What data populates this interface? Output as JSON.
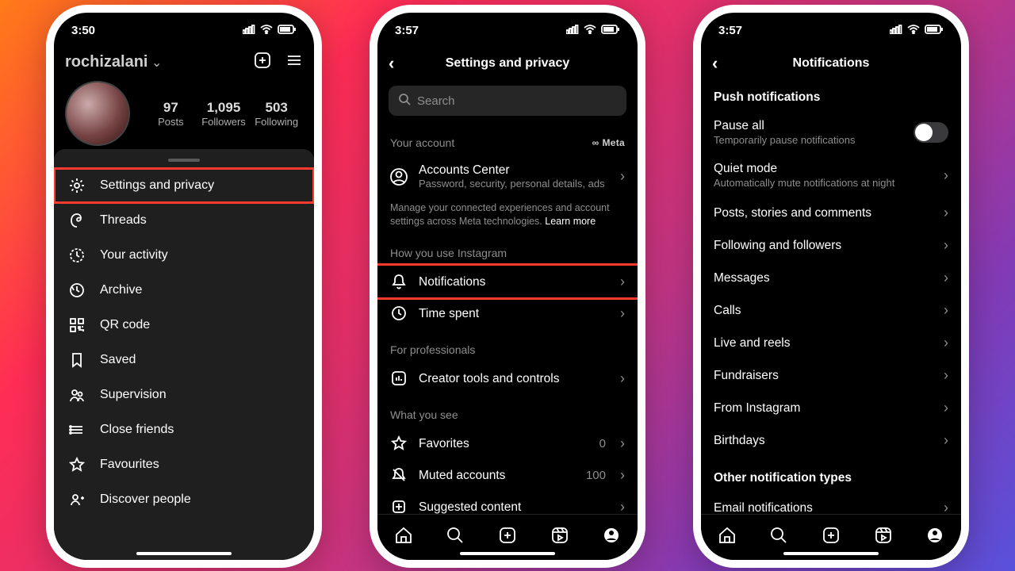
{
  "phone1": {
    "status_time": "3:50",
    "username": "rochizalani",
    "stats": {
      "posts_n": "97",
      "posts_l": "Posts",
      "followers_n": "1,095",
      "followers_l": "Followers",
      "following_n": "503",
      "following_l": "Following"
    },
    "menu": [
      {
        "icon": "gear",
        "label": "Settings and privacy",
        "hl": true
      },
      {
        "icon": "threads",
        "label": "Threads"
      },
      {
        "icon": "activity",
        "label": "Your activity"
      },
      {
        "icon": "archive",
        "label": "Archive"
      },
      {
        "icon": "qr",
        "label": "QR code"
      },
      {
        "icon": "saved",
        "label": "Saved"
      },
      {
        "icon": "supervision",
        "label": "Supervision"
      },
      {
        "icon": "close-friends",
        "label": "Close friends"
      },
      {
        "icon": "star",
        "label": "Favourites"
      },
      {
        "icon": "discover",
        "label": "Discover people"
      }
    ]
  },
  "phone2": {
    "status_time": "3:57",
    "title": "Settings and privacy",
    "search_placeholder": "Search",
    "sec_account_label": "Your account",
    "meta_label": "Meta",
    "ac_title": "Accounts Center",
    "ac_sub": "Password, security, personal details, ads",
    "ac_note": "Manage your connected experiences and account settings across Meta technologies. ",
    "ac_learn": "Learn more",
    "sec_use_label": "How you use Instagram",
    "notifications": "Notifications",
    "time_spent": "Time spent",
    "sec_pro_label": "For professionals",
    "creator": "Creator tools and controls",
    "sec_see_label": "What you see",
    "favorites": "Favorites",
    "favorites_count": "0",
    "muted": "Muted accounts",
    "muted_count": "100",
    "suggested": "Suggested content"
  },
  "phone3": {
    "status_time": "3:57",
    "title": "Notifications",
    "grp1": "Push notifications",
    "pause_t": "Pause all",
    "pause_s": "Temporarily pause notifications",
    "quiet_t": "Quiet mode",
    "quiet_s": "Automatically mute notifications at night",
    "items": [
      "Posts, stories and comments",
      "Following and followers",
      "Messages",
      "Calls",
      "Live and reels",
      "Fundraisers",
      "From Instagram",
      "Birthdays"
    ],
    "grp2": "Other notification types",
    "email": "Email notifications"
  }
}
